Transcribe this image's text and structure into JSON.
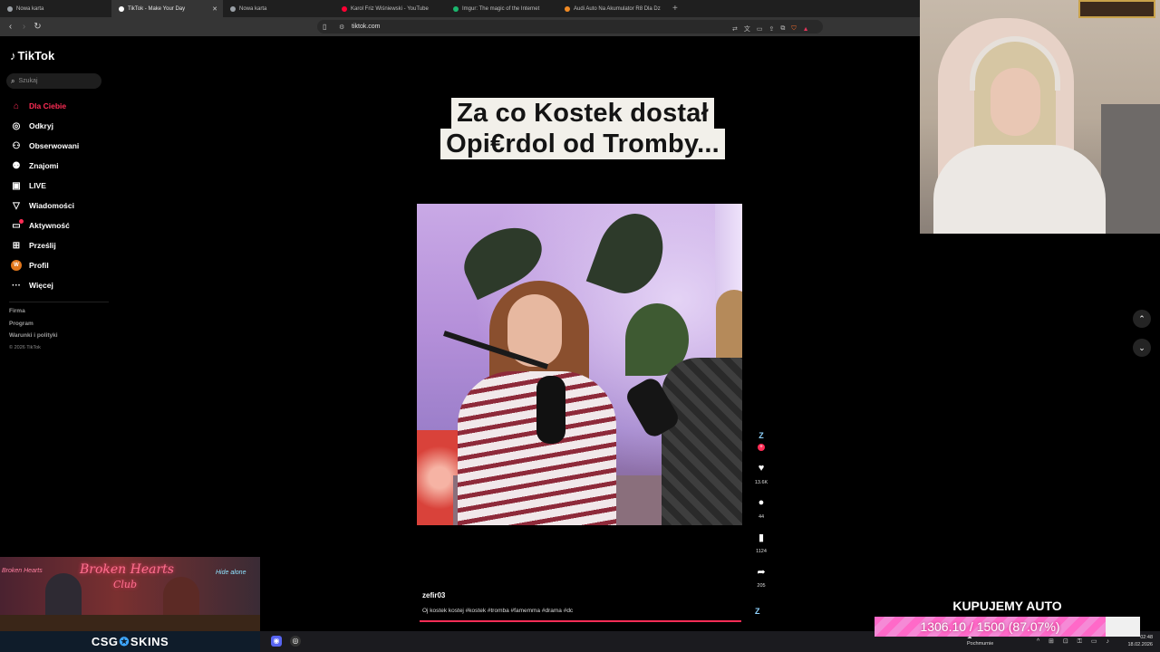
{
  "browser": {
    "tabs": [
      {
        "label": "Nowa karta",
        "color": "#9aa0a6"
      },
      {
        "label": "TikTok - Make Your Day",
        "color": "#ffffff",
        "active": true
      },
      {
        "label": "Nowa karta",
        "color": "#9aa0a6"
      },
      {
        "label": "Karol Friz Wiśniewski - YouTube",
        "color": "#ff0033"
      },
      {
        "label": "Imgur: The magic of the Internet",
        "color": "#1bb76e"
      },
      {
        "label": "Audi Auto Na Akumulator R8 Dla Dz",
        "color": "#f08a24"
      }
    ],
    "close_glyph": "✕",
    "new_tab_glyph": "+",
    "url": "tiktok.com"
  },
  "sidebar": {
    "logo": "TikTok",
    "search_placeholder": "Szukaj",
    "items": [
      {
        "label": "Dla Ciebie",
        "icon": "home-icon"
      },
      {
        "label": "Odkryj",
        "icon": "compass-icon"
      },
      {
        "label": "Obserwowani",
        "icon": "person-icon"
      },
      {
        "label": "Znajomi",
        "icon": "friends-icon"
      },
      {
        "label": "LIVE",
        "icon": "live-icon"
      },
      {
        "label": "Wiadomości",
        "icon": "send-icon"
      },
      {
        "label": "Aktywność",
        "icon": "inbox-icon"
      },
      {
        "label": "Prześlij",
        "icon": "upload-icon"
      },
      {
        "label": "Profil",
        "icon": "avatar"
      },
      {
        "label": "Więcej",
        "icon": "more-icon"
      }
    ],
    "profile_initial": "W",
    "footer": {
      "firma": "Firma",
      "program": "Program",
      "terms": "Warunki i polityki",
      "copyright": "© 2026 TikTok"
    }
  },
  "video": {
    "caption_line1": "Za co Kostek dostał",
    "caption_line2": "Opi€rdol od Tromby...",
    "author": "zefir03",
    "description": "Oj kostek kostej #kostek #tromba #famemma #drama #dc",
    "actions": {
      "likes": "13.6K",
      "comments": "44",
      "saves": "1124",
      "shares": "205"
    }
  },
  "overlay": {
    "banner_title": "Broken Hearts",
    "banner_sub": "Club",
    "banner_neon_left": "Broken Hearts",
    "banner_neon_right": "Hide alone",
    "sponsor_pre": "CSG",
    "sponsor_o": "✪",
    "sponsor_post": "SKINS",
    "goal_title": "KUPUJEMY AUTO",
    "goal_text": "1306.10 / 1500 (87.07%)",
    "goal_fraction": 0.8707
  },
  "taskbar": {
    "weather": "Pochmurnie",
    "time": "02:48",
    "date": "18.02.2026"
  },
  "colors": {
    "accent": "#fe2c55",
    "goal_pink": "#ff69c8"
  }
}
